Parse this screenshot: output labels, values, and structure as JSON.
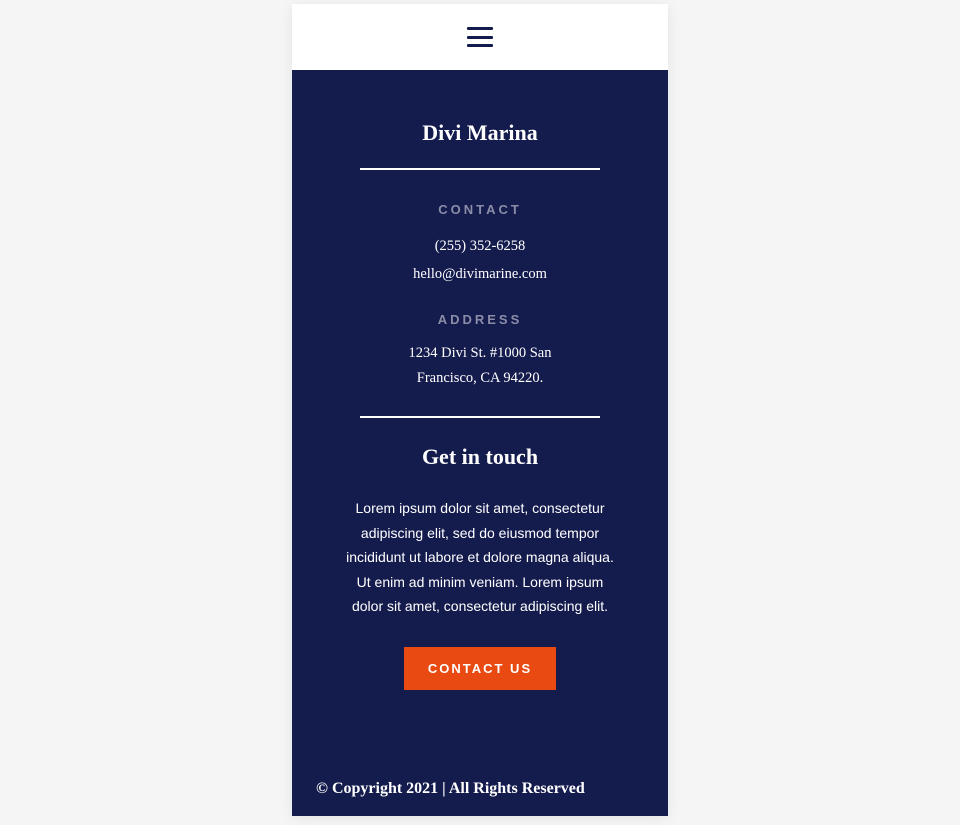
{
  "brand": "Divi Marina",
  "contact": {
    "label": "CONTACT",
    "phone": "(255) 352-6258",
    "email": "hello@divimarine.com"
  },
  "address": {
    "label": "ADDRESS",
    "line1": "1234 Divi St. #1000 San",
    "line2": "Francisco, CA 94220."
  },
  "touch": {
    "title": "Get in touch",
    "text": "Lorem ipsum dolor sit amet, consectetur adipiscing elit, sed do eiusmod tempor incididunt ut labore et dolore magna aliqua. Ut enim ad minim veniam. Lorem ipsum dolor sit amet, consectetur adipiscing elit.",
    "button": "CONTACT US"
  },
  "copyright": "© Copyright 2021 | All Rights Reserved"
}
